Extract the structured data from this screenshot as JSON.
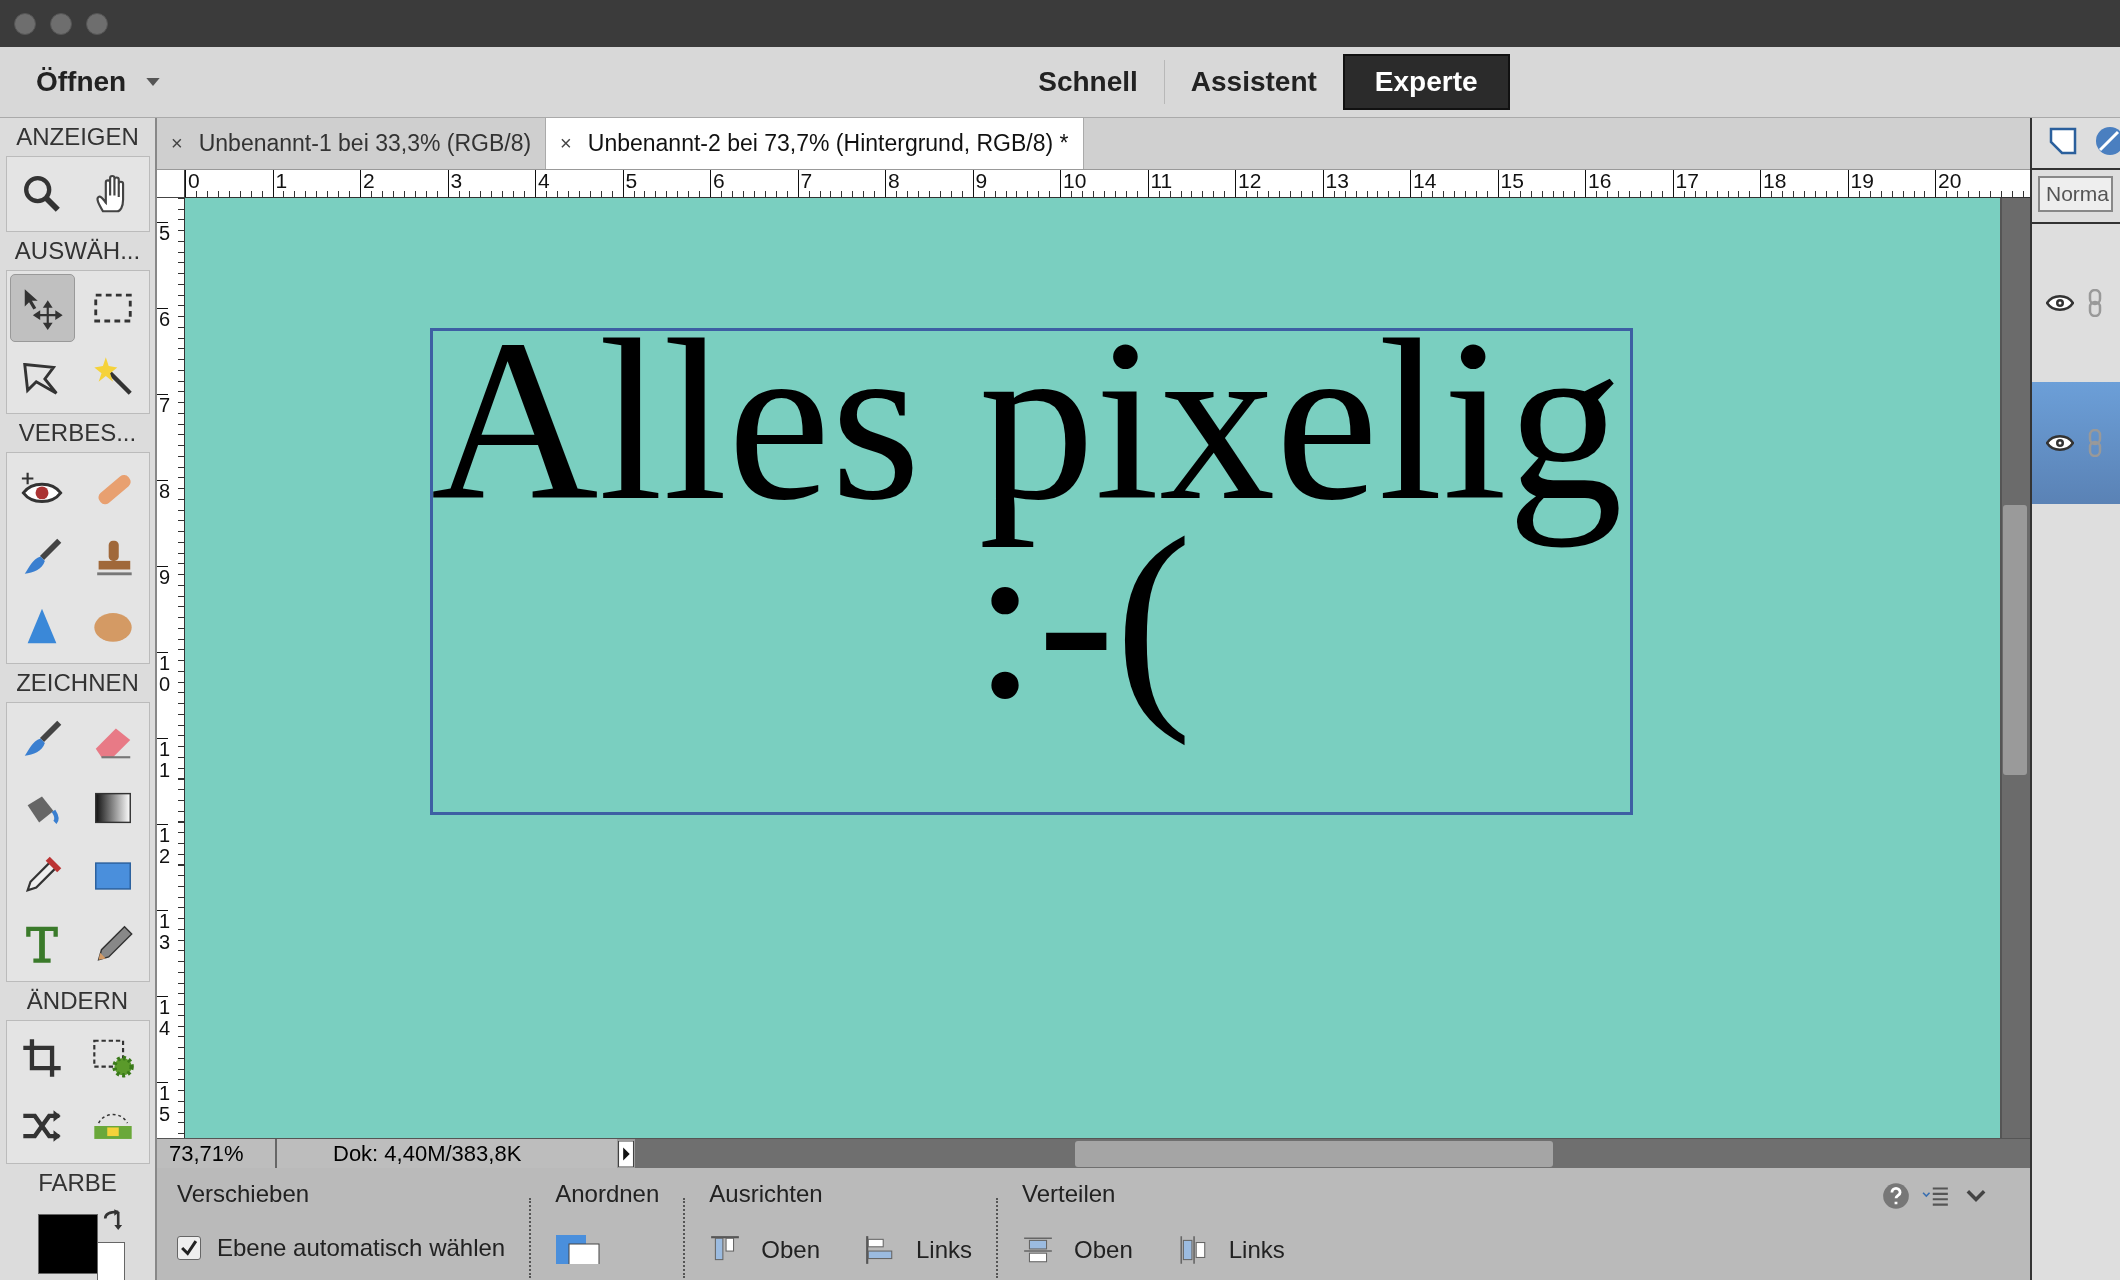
{
  "menu": {
    "open_label": "Öffnen"
  },
  "modes": [
    {
      "label": "Schnell",
      "selected": false
    },
    {
      "label": "Assistent",
      "selected": false
    },
    {
      "label": "Experte",
      "selected": true
    }
  ],
  "toolbox": {
    "groups": [
      {
        "label": "ANZEIGEN",
        "tools": [
          {
            "selected": false
          },
          {
            "selected": false
          }
        ]
      },
      {
        "label": "AUSWÄH...",
        "tools": [
          {
            "selected": true
          },
          {
            "selected": false
          },
          {
            "selected": false
          },
          {
            "selected": false
          }
        ]
      },
      {
        "label": "VERBES...",
        "tools": [
          {
            "selected": false
          },
          {
            "selected": false
          },
          {
            "selected": false
          },
          {
            "selected": false
          },
          {
            "selected": false
          },
          {
            "selected": false
          }
        ]
      },
      {
        "label": "ZEICHNEN",
        "tools": [
          {
            "selected": false
          },
          {
            "selected": false
          },
          {
            "selected": false
          },
          {
            "selected": false
          },
          {
            "selected": false
          },
          {
            "selected": false
          },
          {
            "selected": false
          },
          {
            "selected": false
          }
        ]
      },
      {
        "label": "ÄNDERN",
        "tools": [
          {
            "selected": false
          },
          {
            "selected": false
          },
          {
            "selected": false
          },
          {
            "selected": false
          }
        ]
      }
    ],
    "color_label": "FARBE"
  },
  "tabs": [
    {
      "close": "×",
      "label": "Unbenannt-1 bei 33,3% (RGB/8)",
      "selected": false
    },
    {
      "close": "×",
      "label": "Unbenannt-2 bei 73,7% (Hintergrund, RGB/8) *",
      "selected": true
    }
  ],
  "rulers": {
    "horizontal": [
      "0",
      "1",
      "2",
      "3",
      "4",
      "5",
      "6",
      "7",
      "8",
      "9",
      "10",
      "11",
      "12",
      "13",
      "14",
      "15",
      "16",
      "17",
      "18",
      "19",
      "20"
    ],
    "vertical": [
      "5",
      "6",
      "7",
      "8",
      "9",
      "10",
      "11",
      "12",
      "13",
      "14",
      "15"
    ]
  },
  "canvas": {
    "lines": [
      "Alles pixelig",
      ":-("
    ]
  },
  "status_bar": {
    "zoom": "73,71%",
    "document": "Dok: 4,40M/383,8K"
  },
  "options": {
    "title": "Verschieben",
    "auto_select": {
      "label": "Ebene automatisch wählen",
      "checked": true
    },
    "arrange_label": "Anordnen",
    "align": {
      "label": "Ausrichten",
      "items": [
        "Oben",
        "Links"
      ]
    },
    "distribute": {
      "label": "Verteilen",
      "items": [
        "Oben",
        "Links"
      ]
    }
  },
  "layers_panel": {
    "blend_mode": "Norma",
    "layers": [
      {
        "selected": false
      },
      {
        "selected": true
      }
    ]
  }
}
